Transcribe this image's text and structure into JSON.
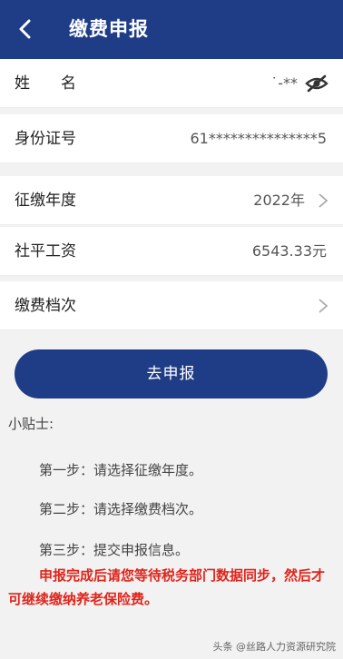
{
  "header": {
    "title": "缴费申报"
  },
  "rows": {
    "name": {
      "label": "姓　　名",
      "value": "˙-**"
    },
    "id_number": {
      "label": "身份证号",
      "value": "61***************5"
    },
    "year": {
      "label": "征缴年度",
      "value": "2022年"
    },
    "salary": {
      "label": "社平工资",
      "value": "6543.33元"
    },
    "level": {
      "label": "缴费档次",
      "value": ""
    }
  },
  "submit_button": {
    "label": "去申报"
  },
  "tips": {
    "title": "小贴士:",
    "steps": [
      "第一步：请选择征缴年度。",
      "第二步：请选择缴费档次。",
      "第三步：提交申报信息。"
    ],
    "warning": "申报完成后请您等待税务部门数据同步，然后才可继续缴纳养老保险费。"
  },
  "watermark": "头条 @丝路人力资源研究院",
  "colors": {
    "primary": "#1f3c86",
    "warning": "#e0241b"
  }
}
